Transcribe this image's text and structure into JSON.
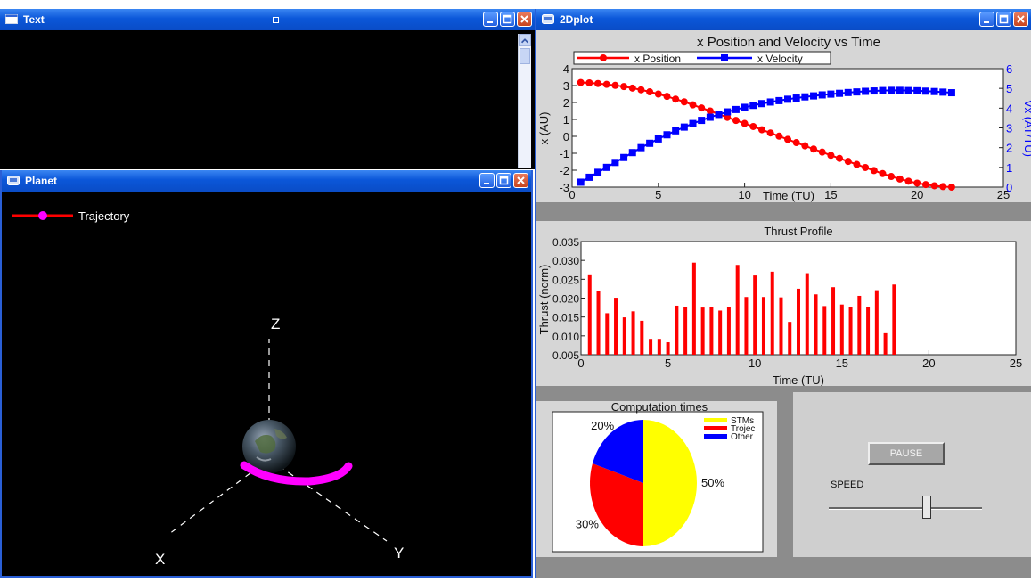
{
  "text_window": {
    "title": "Text"
  },
  "planet_window": {
    "title": "Planet",
    "legend_label": "Trajectory",
    "axes": {
      "x": "X",
      "y": "Y",
      "z": "Z"
    }
  },
  "plot_window": {
    "title": "2Dplot"
  },
  "colors": {
    "position": "#ff0000",
    "velocity": "#0000ff",
    "trajectory": "#ff00ff",
    "stms": "#ffff00",
    "trojec": "#ff0000",
    "other": "#0000ff"
  },
  "chart_data": [
    {
      "type": "line",
      "title": "x Position and Velocity vs Time",
      "xlabel": "Time (TU)",
      "ylabel": "x (AU)",
      "y2label": "Vx (AT/TU)",
      "xlim": [
        0,
        25
      ],
      "ylim": [
        -3,
        4
      ],
      "y2lim": [
        0,
        6
      ],
      "xticks": [
        0,
        5,
        10,
        15,
        20,
        25
      ],
      "yticks": [
        -3,
        -2,
        -1,
        0,
        1,
        2,
        3,
        4
      ],
      "y2ticks": [
        0,
        1,
        2,
        3,
        4,
        5,
        6
      ],
      "legend_position": "top",
      "series": [
        {
          "name": "x Position",
          "axis": "left",
          "marker": "circle",
          "x": [
            0.5,
            1.0,
            1.5,
            2.0,
            2.5,
            3.0,
            3.5,
            4.0,
            4.5,
            5.0,
            5.5,
            6.0,
            6.5,
            7.0,
            7.5,
            8.0,
            8.5,
            9.0,
            9.5,
            10.0,
            10.5,
            11.0,
            11.5,
            12.0,
            12.5,
            13.0,
            13.5,
            14.0,
            14.5,
            15.0,
            15.5,
            16.0,
            16.5,
            17.0,
            17.5,
            18.0,
            18.5,
            19.0,
            19.5,
            20.0,
            20.5,
            21.0,
            21.5,
            22.0
          ],
          "y": [
            3.18,
            3.16,
            3.12,
            3.07,
            3.01,
            2.94,
            2.85,
            2.75,
            2.63,
            2.5,
            2.36,
            2.2,
            2.04,
            1.86,
            1.68,
            1.5,
            1.31,
            1.12,
            0.94,
            0.76,
            0.58,
            0.39,
            0.2,
            0.01,
            -0.18,
            -0.37,
            -0.56,
            -0.75,
            -0.93,
            -1.12,
            -1.3,
            -1.48,
            -1.66,
            -1.84,
            -2.02,
            -2.2,
            -2.37,
            -2.52,
            -2.65,
            -2.76,
            -2.85,
            -2.92,
            -2.97,
            -3.0
          ]
        },
        {
          "name": "x Velocity",
          "axis": "right",
          "marker": "square",
          "x": [
            0.5,
            1.0,
            1.5,
            2.0,
            2.5,
            3.0,
            3.5,
            4.0,
            4.5,
            5.0,
            5.5,
            6.0,
            6.5,
            7.0,
            7.5,
            8.0,
            8.5,
            9.0,
            9.5,
            10.0,
            10.5,
            11.0,
            11.5,
            12.0,
            12.5,
            13.0,
            13.5,
            14.0,
            14.5,
            15.0,
            15.5,
            16.0,
            16.5,
            17.0,
            17.5,
            18.0,
            18.5,
            19.0,
            19.5,
            20.0,
            20.5,
            21.0,
            21.5,
            22.0
          ],
          "y": [
            0.25,
            0.5,
            0.75,
            1.0,
            1.25,
            1.5,
            1.75,
            2.0,
            2.22,
            2.44,
            2.65,
            2.85,
            3.04,
            3.22,
            3.38,
            3.54,
            3.68,
            3.81,
            3.93,
            4.04,
            4.14,
            4.23,
            4.31,
            4.38,
            4.45,
            4.51,
            4.57,
            4.62,
            4.67,
            4.71,
            4.75,
            4.79,
            4.82,
            4.85,
            4.87,
            4.89,
            4.9,
            4.9,
            4.89,
            4.88,
            4.86,
            4.84,
            4.81,
            4.78
          ]
        }
      ]
    },
    {
      "type": "bar",
      "title": "Thrust Profile",
      "xlabel": "Time (TU)",
      "ylabel": "Thrust (norm)",
      "xlim": [
        0,
        25
      ],
      "ylim": [
        0.005,
        0.035
      ],
      "xticks": [
        0,
        5,
        10,
        15,
        20,
        25
      ],
      "yticks": [
        0.005,
        0.01,
        0.015,
        0.02,
        0.025,
        0.03,
        0.035
      ],
      "ytick_labels": [
        "0.005",
        "0.010",
        "0.015",
        "0.020",
        "0.025",
        "0.030",
        "0.035"
      ],
      "x": [
        0.5,
        1.0,
        1.5,
        2.0,
        2.5,
        3.0,
        3.5,
        4.0,
        4.5,
        5.0,
        5.5,
        6.0,
        6.5,
        7.0,
        7.5,
        8.0,
        8.5,
        9.0,
        9.5,
        10.0,
        10.5,
        11.0,
        11.5,
        12.0,
        12.5,
        13.0,
        13.5,
        14.0,
        14.5,
        15.0,
        15.5,
        16.0,
        16.5,
        17.0,
        17.5,
        18.0,
        18.5,
        19.0,
        19.5,
        20.0,
        20.5,
        21.0,
        21.5,
        22.0
      ],
      "values": [
        0.0263,
        0.022,
        0.016,
        0.0201,
        0.0149,
        0.0165,
        0.014,
        0.0092,
        0.0092,
        0.0083,
        0.018,
        0.0177,
        0.0294,
        0.0175,
        0.0177,
        0.0167,
        0.0177,
        0.0288,
        0.0203,
        0.026,
        0.0203,
        0.027,
        0.0202,
        0.0137,
        0.0225,
        0.0266,
        0.021,
        0.0179,
        0.0229,
        0.0183,
        0.0177,
        0.0206,
        0.0176,
        0.0221,
        0.0107,
        0.0236,
        0.0,
        0.0,
        0.0,
        0.0,
        0.0,
        0.0,
        0.0,
        0.0
      ]
    },
    {
      "type": "pie",
      "title": "Computation times",
      "legend_position": "top-right",
      "slices": [
        {
          "name": "STMs",
          "value": 50,
          "label": "50%"
        },
        {
          "name": "Trojec",
          "value": 30,
          "label": "30%"
        },
        {
          "name": "Other",
          "value": 20,
          "label": "20%"
        }
      ]
    }
  ],
  "controls": {
    "pause_label": "PAUSE",
    "speed_label": "SPEED",
    "speed_value": 0.64
  }
}
